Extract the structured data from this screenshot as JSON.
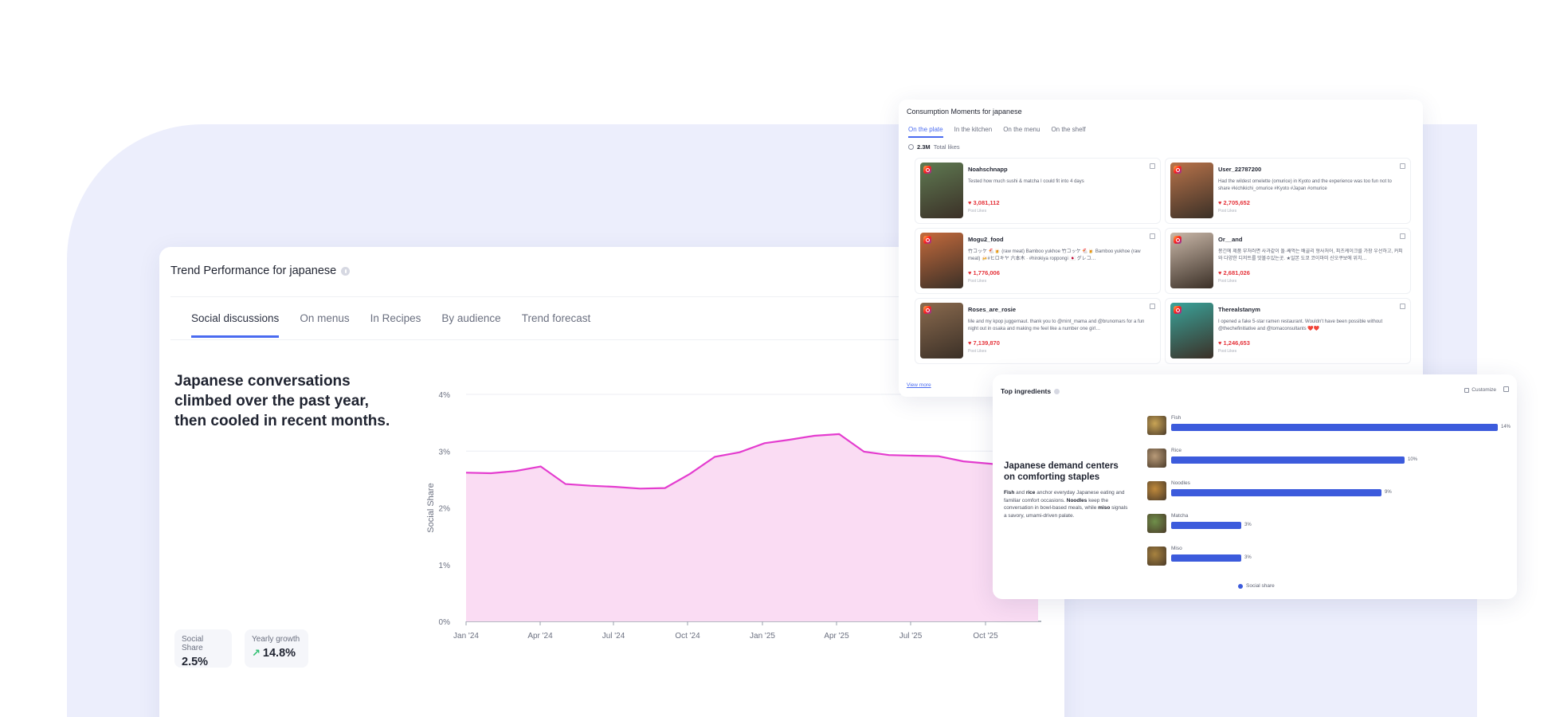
{
  "trend": {
    "title": "Trend Performance for japanese",
    "tabs": [
      "Social discussions",
      "On menus",
      "In Recipes",
      "By audience",
      "Trend forecast"
    ],
    "headline": "Japanese conversations climbed over the past year, then cooled in recent months.",
    "metrics": {
      "social_share_label": "Social Share",
      "social_share_value": "2.5%",
      "yearly_growth_label": "Yearly growth",
      "yearly_growth_value": "14.8%"
    }
  },
  "chart_data": {
    "type": "area",
    "ylabel": "Social Share",
    "xlabel": "",
    "ylim": [
      0,
      4
    ],
    "yticks": [
      "0%",
      "1%",
      "2%",
      "3%",
      "4%"
    ],
    "xticks": [
      "Jan '24",
      "Apr '24",
      "Jul '24",
      "Oct '24",
      "Jan '25",
      "Apr '25",
      "Jul '25",
      "Oct '25"
    ],
    "x_month_index": [
      0,
      1,
      2,
      3,
      4,
      5,
      6,
      7,
      8,
      9,
      10,
      11,
      12,
      13,
      14,
      15,
      16,
      17,
      18,
      19,
      20,
      21,
      22,
      23
    ],
    "values": [
      2.62,
      2.61,
      2.65,
      2.73,
      2.42,
      2.39,
      2.37,
      2.34,
      2.35,
      2.6,
      2.9,
      2.98,
      3.14,
      3.2,
      3.27,
      3.3,
      2.99,
      2.93,
      2.92,
      2.91,
      2.82,
      2.78,
      2.74,
      2.7
    ],
    "series": [
      {
        "values": [
          2.62,
          2.61,
          2.65,
          2.73,
          2.42,
          2.39,
          2.37,
          2.34,
          2.35,
          2.6,
          2.9,
          2.98,
          3.14,
          3.2,
          3.27,
          3.3,
          2.99,
          2.93,
          2.92,
          2.91,
          2.82,
          2.78,
          2.74,
          2.7
        ]
      }
    ],
    "grid": true,
    "line_color": "#e43ccf",
    "fill_color": "#fadcf3"
  },
  "consumption": {
    "title": "Consumption Moments for japanese",
    "tabs": [
      "On the plate",
      "In the kitchen",
      "On the menu",
      "On the shelf"
    ],
    "total_likes_value": "2.3M",
    "total_likes_label": "Total likes",
    "posts": [
      {
        "user": "Noahschnapp",
        "text": "Tested how much sushi & matcha I could fit into 4 days",
        "likes": "♥ 3,081,112",
        "likes_label": "Post Likes",
        "thumb": "#5f7a52"
      },
      {
        "user": "User_22787200",
        "text": "Had the wildest omelette (omurice) in Kyoto and the experience was too fun not to share #kichikichi_omurice #Kyoto #Japan #omurice",
        "likes": "♥ 2,705,652",
        "likes_label": "Post Likes",
        "thumb": "#b8734a"
      },
      {
        "user": "Mogu2_food",
        "text": "竹コッケ 🐔🍺 (raw meat) Bamboo yukhoe 竹コッケ 🐔🍺 Bamboo yukhoe (raw meat) 🍻#ヒロキヤ 六本木 · #hirokiya roppongi 🇯🇵 グレコ…",
        "likes": "♥ 1,776,006",
        "likes_label": "Post Likes",
        "thumb": "#c46a3c"
      },
      {
        "user": "Or__and",
        "text": "몽긴에 제품 부처러면 사과같이 돌·쌔먹는 배콜리 형사처어, 피츠케이크를 가장 우선하고, 커피와 다양한 디저트를 맛볼수있는곳. ★일본 도쿄 코이마미 신오쿠보에 위치…",
        "likes": "♥ 2,681,026",
        "likes_label": "Post Likes",
        "thumb": "#c9b7a8"
      },
      {
        "user": "Roses_are_rosie",
        "text": "Me and my kpop juggernaut. thank you to @mint_mama and @brunomars for a fun night out in osaka and making me feel like a number one girl…",
        "likes": "♥ 7,139,870",
        "likes_label": "Post Likes",
        "thumb": "#8a6a4e"
      },
      {
        "user": "Therealstanym",
        "text": "I opened a fake 5-star ramen restaurant. Wouldn't have been possible without @thechefinitiative and @tomaconsultants ❤️❤️",
        "likes": "♥ 1,246,653",
        "likes_label": "Post Likes",
        "thumb": "#3aa39a"
      }
    ],
    "view_more": "View more"
  },
  "ingredients": {
    "title": "Top ingredients",
    "customize": "Customize",
    "headline": "Japanese demand centers on comforting staples",
    "desc_parts": {
      "p1": "Fish",
      "p2": " and ",
      "p3": "rice",
      "p4": " anchor everyday Japanese eating and familiar comfort occasions. ",
      "p5": "Noodles",
      "p6": " keep the conversation in bowl-based meals, while ",
      "p7": "miso",
      "p8": " signals a savory, umami-driven palate."
    },
    "legend": "Social share",
    "items": [
      {
        "name": "Fish",
        "value": 14,
        "label": "14%",
        "thumb": "#c9a455"
      },
      {
        "name": "Rice",
        "value": 10,
        "label": "10%",
        "thumb": "#b89a78"
      },
      {
        "name": "Noodles",
        "value": 9,
        "label": "9%",
        "thumb": "#c08a3c"
      },
      {
        "name": "Matcha",
        "value": 3,
        "label": "3%",
        "thumb": "#6f8f4a"
      },
      {
        "name": "Miso",
        "value": 3,
        "label": "3%",
        "thumb": "#a7823f"
      }
    ],
    "max_value": 14,
    "bar_color": "#3c5bdc"
  }
}
